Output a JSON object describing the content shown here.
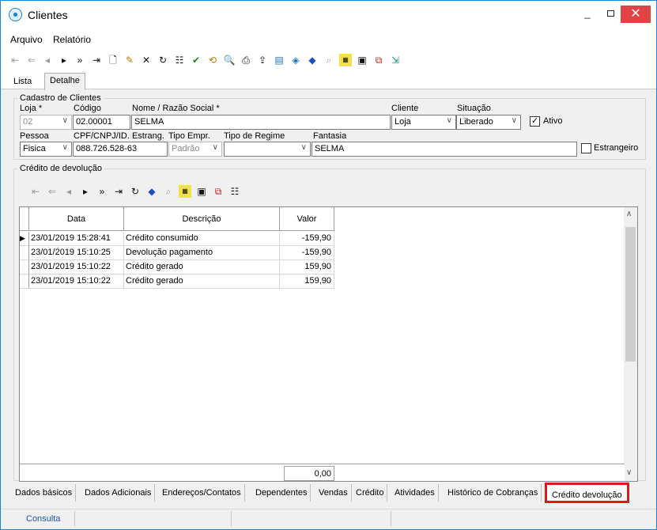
{
  "window": {
    "title": "Clientes"
  },
  "menu": {
    "items": [
      {
        "label": "Arquivo"
      },
      {
        "label": "Relatório"
      }
    ]
  },
  "toolbar": {
    "buttons": [
      {
        "icon": "first-record-icon"
      },
      {
        "icon": "previous-page-icon"
      },
      {
        "icon": "previous-record-icon"
      },
      {
        "icon": "next-record-icon"
      },
      {
        "icon": "next-page-icon"
      },
      {
        "icon": "last-record-icon"
      },
      {
        "icon": "new-document-icon"
      },
      {
        "icon": "edit-icon"
      },
      {
        "icon": "delete-icon"
      },
      {
        "icon": "refresh-icon"
      },
      {
        "icon": "properties-icon"
      },
      {
        "icon": "confirm-icon"
      },
      {
        "icon": "cancel-icon"
      },
      {
        "icon": "preview-icon"
      },
      {
        "icon": "print-icon"
      },
      {
        "icon": "export-icon"
      },
      {
        "icon": "report-icon"
      },
      {
        "icon": "filter-clear-icon"
      },
      {
        "icon": "tag-icon"
      },
      {
        "icon": "goto-icon"
      },
      {
        "icon": "filter-icon"
      },
      {
        "icon": "save-icon"
      },
      {
        "icon": "copy-icon"
      },
      {
        "icon": "exit-icon"
      }
    ]
  },
  "tabs_top": [
    {
      "label": "Lista"
    },
    {
      "label": "Detalhe"
    }
  ],
  "cadastro": {
    "group_title": "Cadastro de Clientes",
    "loja_label": "Loja *",
    "loja_value": "02",
    "codigo_label": "Código",
    "codigo_value": "02.00001",
    "nome_label": "Nome / Razão Social *",
    "nome_value": "SELMA",
    "cliente_label": "Cliente",
    "cliente_value": "Loja",
    "situacao_label": "Situação",
    "situacao_value": "Liberado",
    "ativo_label": "Ativo",
    "ativo_checked": true,
    "pessoa_label": "Pessoa",
    "pessoa_value": "Fisica",
    "cpf_label": "CPF/CNPJ/ID. Estrang.",
    "cpf_value": "088.726.528-63",
    "tipo_empr_label": "Tipo Empr.",
    "tipo_empr_value": "Padrão",
    "tipo_regime_label": "Tipo de Regime",
    "tipo_regime_value": "",
    "fantasia_label": "Fantasia",
    "fantasia_value": "SELMA",
    "estrangeiro_label": "Estrangeiro",
    "estrangeiro_checked": false
  },
  "credito": {
    "group_title": "Crédito de devolução",
    "columns": [
      "Data",
      "Descrição",
      "Valor"
    ],
    "rows": [
      {
        "data": "23/01/2019 15:28:41",
        "descricao": "Crédito consumido",
        "valor": "-159,90",
        "current": true
      },
      {
        "data": "23/01/2019 15:10:25",
        "descricao": "Devolução pagamento",
        "valor": "-159,90",
        "current": false
      },
      {
        "data": "23/01/2019 15:10:22",
        "descricao": "Crédito gerado",
        "valor": "159,90",
        "current": false
      },
      {
        "data": "23/01/2019 15:10:22",
        "descricao": "Crédito gerado",
        "valor": "159,90",
        "current": false
      }
    ],
    "total": "0,00"
  },
  "bottom_tabs": [
    {
      "label": "Dados básicos"
    },
    {
      "label": "Dados Adicionais"
    },
    {
      "label": "Endereços/Contatos"
    },
    {
      "label": "Dependentes"
    },
    {
      "label": "Vendas"
    },
    {
      "label": "Crédito"
    },
    {
      "label": "Atividades"
    },
    {
      "label": "Histórico de Cobranças"
    },
    {
      "label": "Crédito devolução"
    }
  ],
  "status": {
    "panel1": "Consulta"
  },
  "colors": {
    "highlight": "#e01818",
    "title_border": "#1883d7",
    "close_button": "#e04343"
  }
}
